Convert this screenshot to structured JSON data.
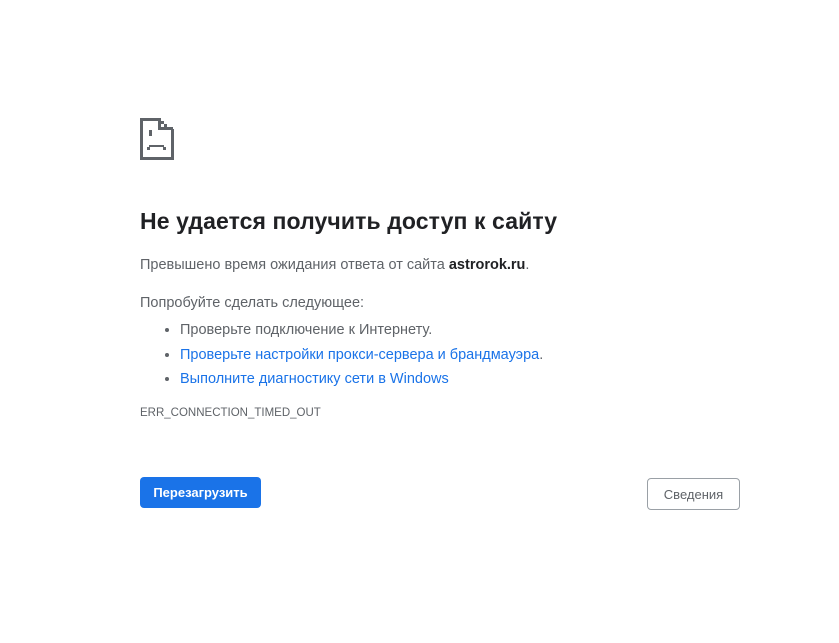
{
  "icon": "sad-page-icon",
  "heading": "Не удается получить доступ к сайту",
  "summary": {
    "prefix": "Превышено время ожидания ответа от сайта ",
    "host": "astrorok.ru",
    "suffix": "."
  },
  "suggestions_title": "Попробуйте сделать следующее:",
  "suggestions": [
    {
      "text": "Проверьте подключение к Интернету.",
      "link": false
    },
    {
      "text": "Проверьте настройки прокси-сервера и брандмауэра",
      "suffix": ".",
      "link": true
    },
    {
      "text": "Выполните диагностику сети в Windows",
      "link": true
    }
  ],
  "error_code": "ERR_CONNECTION_TIMED_OUT",
  "buttons": {
    "reload": "Перезагрузить",
    "details": "Сведения"
  },
  "colors": {
    "accent": "#1a73e8",
    "heading": "#202124",
    "text": "#5f6368"
  }
}
